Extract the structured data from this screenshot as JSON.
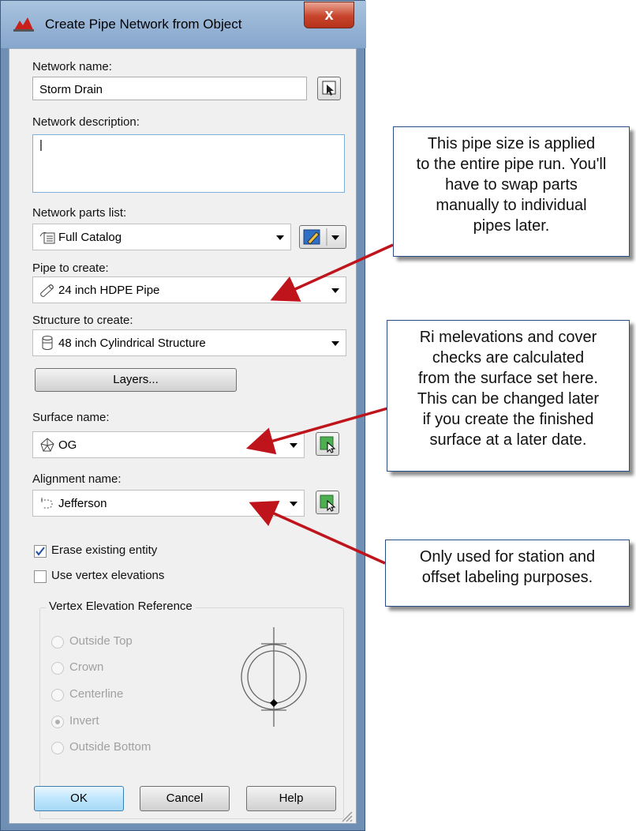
{
  "dialog": {
    "title": "Create Pipe Network from Object",
    "close_label": "x",
    "network_name_label": "Network name:",
    "network_name_value": "Storm Drain",
    "network_description_label": "Network description:",
    "network_description_value": "|",
    "parts_list_label": "Network parts list:",
    "parts_list_value": "Full Catalog",
    "pipe_label": "Pipe to create:",
    "pipe_value": "24 inch HDPE Pipe",
    "structure_label": "Structure to create:",
    "structure_value": "48 inch Cylindrical Structure",
    "layers_button": "Layers...",
    "surface_label": "Surface name:",
    "surface_value": "OG",
    "alignment_label": "Alignment name:",
    "alignment_value": "Jefferson",
    "erase_checkbox_label": "Erase existing entity",
    "erase_checked": true,
    "vertex_checkbox_label": "Use vertex elevations",
    "vertex_checked": false,
    "vertex_group_title": "Vertex Elevation Reference",
    "vertex_options": [
      "Outside Top",
      "Crown",
      "Centerline",
      "Invert",
      "Outside Bottom"
    ],
    "vertex_selected": "Invert",
    "ok_button": "OK",
    "cancel_button": "Cancel",
    "help_button": "Help"
  },
  "callouts": {
    "pipe_size": [
      "This pipe size is applied",
      "to the entire pipe run. You'll",
      "have to swap parts",
      "manually to individual",
      "pipes later."
    ],
    "surface": [
      "Ri melevations and cover",
      "checks are calculated",
      "from the surface set here.",
      "This can be changed later",
      "if you create the finished",
      "surface at a later date."
    ],
    "alignment": [
      "Only used for station and",
      "offset labeling purposes."
    ]
  },
  "colors": {
    "arrow": "#c0141c",
    "callout_border": "#2b4d86",
    "title_bar": "#9bb8d9"
  }
}
